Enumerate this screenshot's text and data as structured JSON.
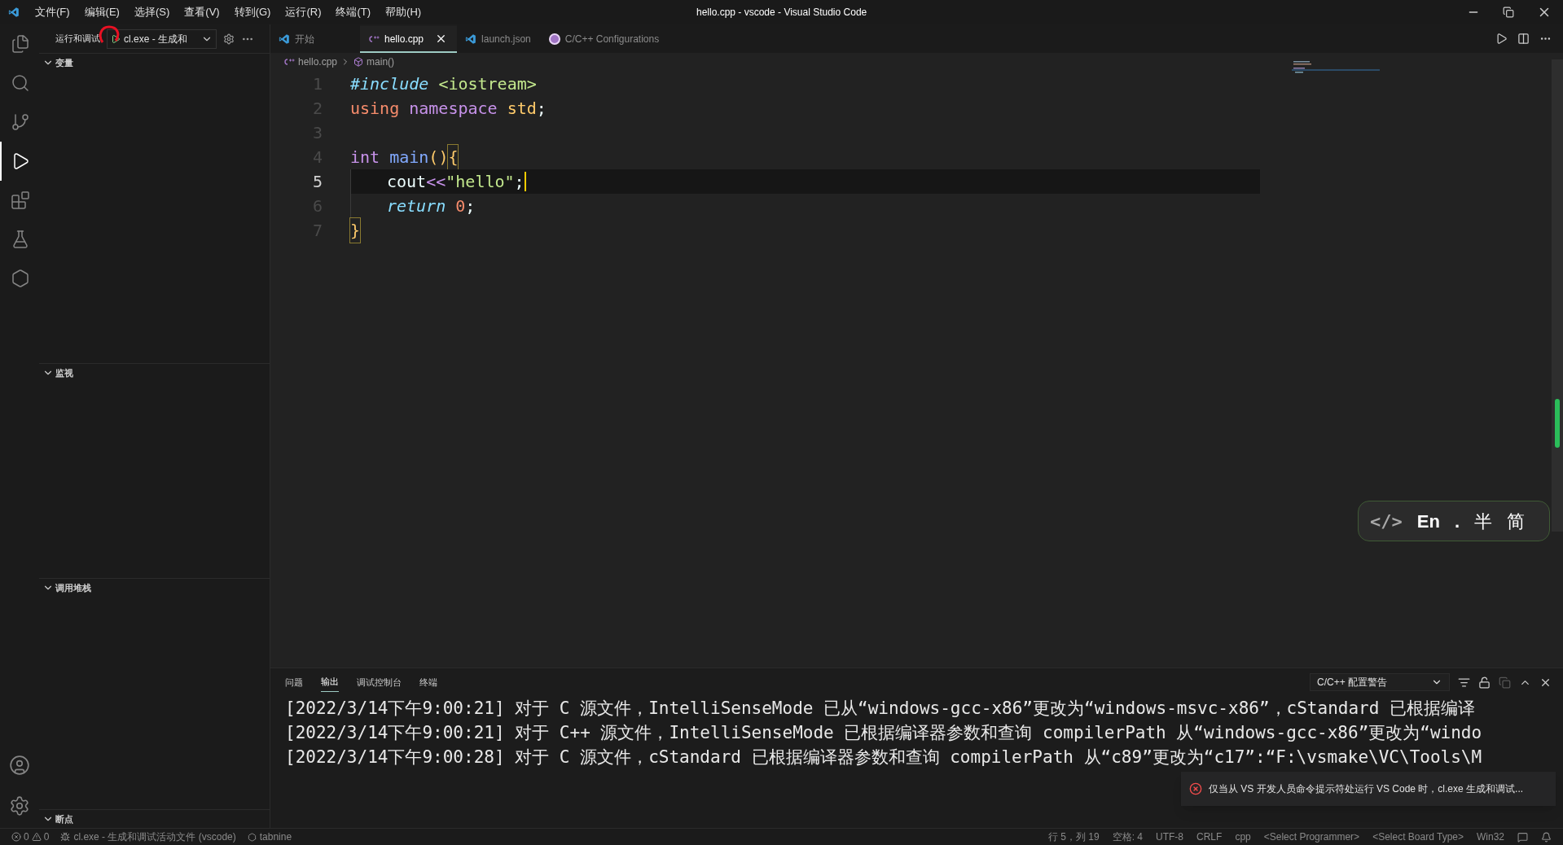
{
  "window": {
    "title": "hello.cpp - vscode - Visual Studio Code"
  },
  "menu": [
    "文件(F)",
    "编辑(E)",
    "选择(S)",
    "查看(V)",
    "转到(G)",
    "运行(R)",
    "终端(T)",
    "帮助(H)"
  ],
  "activity_bar": [
    {
      "kind": "files",
      "selected": false
    },
    {
      "kind": "search",
      "selected": false
    },
    {
      "kind": "source-control",
      "selected": false
    },
    {
      "kind": "run-debug",
      "selected": true
    },
    {
      "kind": "extensions",
      "selected": false
    },
    {
      "kind": "testing",
      "selected": false
    },
    {
      "kind": "remote",
      "selected": false
    }
  ],
  "sidebar": {
    "title": "运行和调试",
    "config": "cl.exe - 生成和",
    "sections": [
      {
        "title": "变量",
        "expanded": true
      },
      {
        "title": "监视",
        "expanded": true
      },
      {
        "title": "调用堆栈",
        "expanded": true
      },
      {
        "title": "断点",
        "expanded": true
      }
    ]
  },
  "tabs": [
    {
      "label": "开始",
      "kind": "vscode",
      "selected": false
    },
    {
      "label": "hello.cpp",
      "kind": "cpp",
      "selected": true
    },
    {
      "label": "launch.json",
      "kind": "vscode",
      "selected": false
    },
    {
      "label": "C/C++ Configurations",
      "kind": "cpp-ext",
      "selected": false
    }
  ],
  "breadcrumb": [
    {
      "label": "hello.cpp",
      "kind": "cpp"
    },
    {
      "label": "main()",
      "kind": "symbol"
    }
  ],
  "editor": {
    "lines": [
      {
        "number": "1",
        "current": false,
        "tokens": [
          {
            "text": "#include ",
            "kind": "directive"
          },
          {
            "text": "<iostream>",
            "kind": "header"
          }
        ]
      },
      {
        "number": "2",
        "current": false,
        "tokens": [
          {
            "text": "using ",
            "kind": "keyword"
          },
          {
            "text": "namespace ",
            "kind": "storage"
          },
          {
            "text": "std",
            "kind": "type"
          },
          {
            "text": ";",
            "kind": "plain"
          }
        ]
      },
      {
        "number": "3",
        "current": false
      },
      {
        "number": "4",
        "current": false,
        "tokens": [
          {
            "text": "int ",
            "kind": "storage"
          },
          {
            "text": "main",
            "kind": "function"
          },
          {
            "text": "()",
            "kind": "paren"
          },
          {
            "text": "{",
            "kind": "paren",
            "matched": true
          }
        ]
      },
      {
        "number": "5",
        "current": true,
        "indented": true,
        "cursor": true,
        "tokens": [
          {
            "text": "cout",
            "kind": "plain"
          },
          {
            "text": "<<",
            "kind": "storage"
          },
          {
            "text": "\"hello\"",
            "kind": "header"
          },
          {
            "text": ";",
            "kind": "plain"
          }
        ]
      },
      {
        "number": "6",
        "current": false,
        "indented": true,
        "tokens": [
          {
            "text": "return ",
            "kind": "directive"
          },
          {
            "text": "0",
            "kind": "keyword"
          },
          {
            "text": ";",
            "kind": "plain"
          }
        ]
      },
      {
        "number": "7",
        "current": false,
        "tokens": [
          {
            "text": "}",
            "kind": "paren",
            "matched": true
          }
        ]
      }
    ]
  },
  "ime": {
    "icon_text": "</>",
    "mode": "En",
    "dot": ".",
    "width": "半",
    "script": "简"
  },
  "panel": {
    "tabs": [
      {
        "label": "问题",
        "selected": false
      },
      {
        "label": "输出",
        "selected": true
      },
      {
        "label": "调试控制台",
        "selected": false
      },
      {
        "label": "终端",
        "selected": false
      }
    ],
    "channel": "C/C++ 配置警告",
    "lines": [
      "[2022/3/14下午9:00:21] 对于 C 源文件，IntelliSenseMode 已从“windows-gcc-x86”更改为“windows-msvc-x86”，cStandard 已根据编译",
      "[2022/3/14下午9:00:21] 对于 C++ 源文件，IntelliSenseMode 已根据编译器参数和查询 compilerPath 从“windows-gcc-x86”更改为“windo",
      "[2022/3/14下午9:00:28] 对于 C 源文件，cStandard 已根据编译器参数和查询 compilerPath 从“c89”更改为“c17”:“F:\\vsmake\\VC\\Tools\\M"
    ]
  },
  "notification": {
    "text": "仅当从 VS 开发人员命令提示符处运行 VS Code 时，cl.exe 生成和调试..."
  },
  "status_bar": {
    "errors": "0",
    "warnings": "0",
    "launch": "cl.exe - 生成和调试活动文件 (vscode)",
    "tabnine": "tabnine",
    "right": [
      "行 5，列 19",
      "空格: 4",
      "UTF-8",
      "CRLF",
      "cpp",
      "<Select Programmer>",
      "<Select Board Type>",
      "Win32"
    ]
  }
}
